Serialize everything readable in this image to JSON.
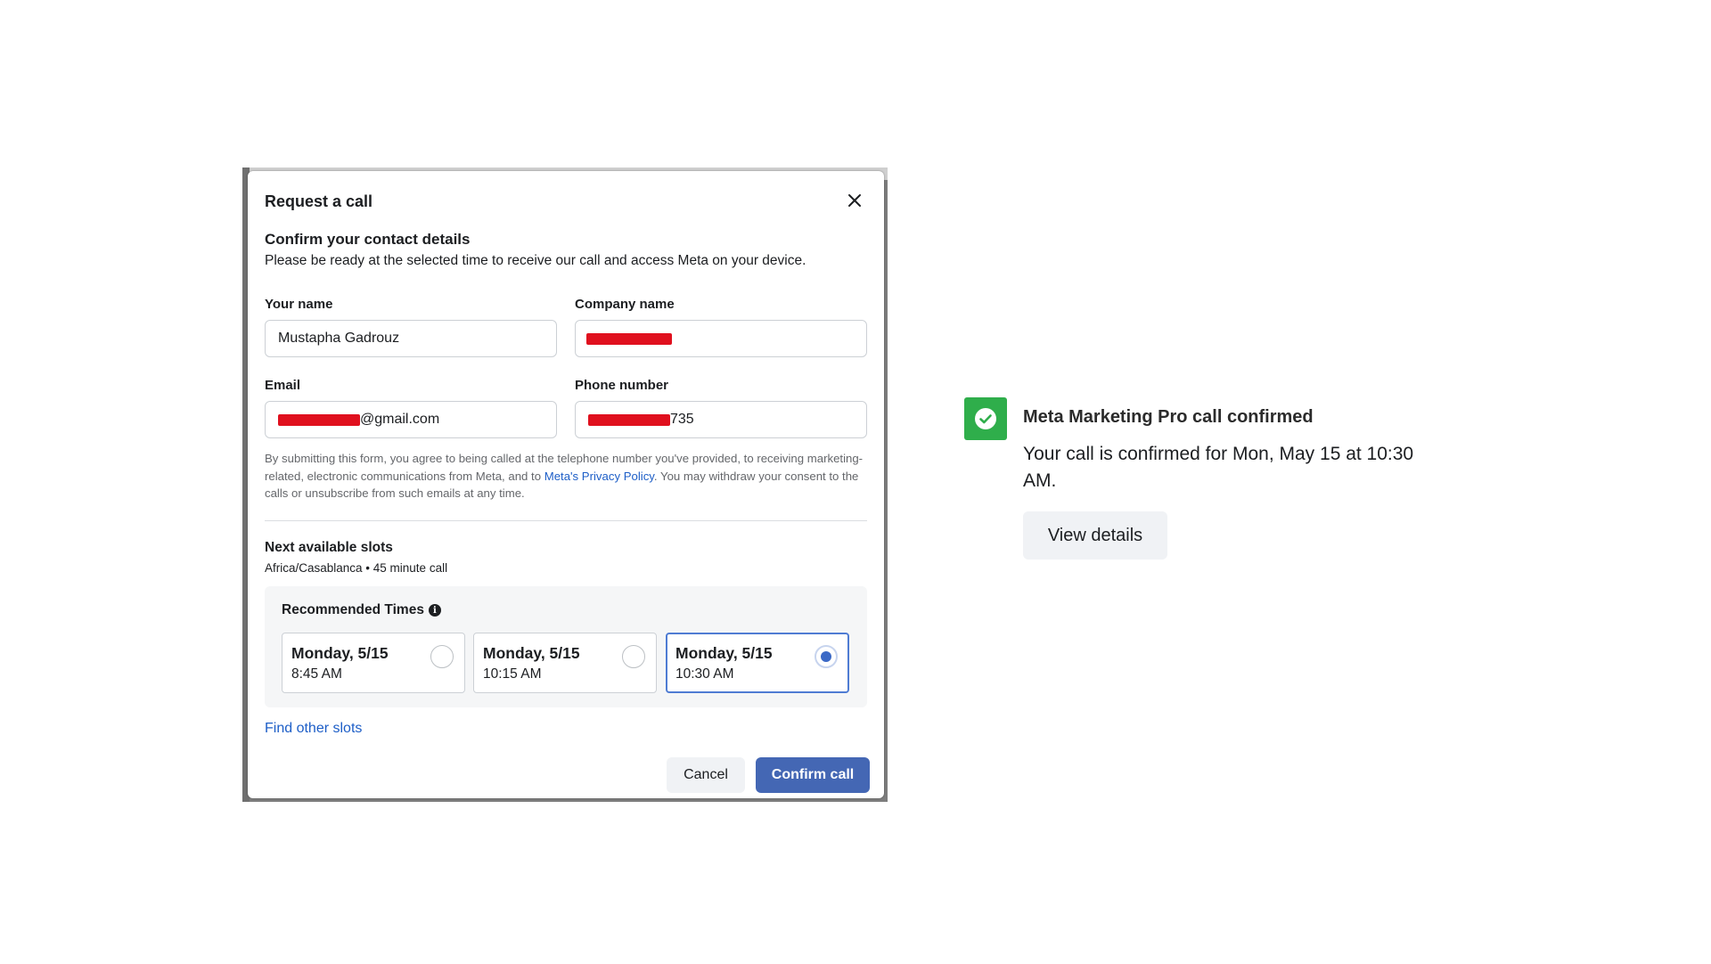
{
  "modal": {
    "title": "Request a call",
    "heading": "Confirm your contact details",
    "subheading": "Please be ready at the selected time to receive our call and access Meta on your device.",
    "fields": {
      "name": {
        "label": "Your name",
        "value": "Mustapha Gadrouz"
      },
      "company": {
        "label": "Company name",
        "value": ""
      },
      "email": {
        "label": "Email",
        "value_visible_suffix": "@gmail.com"
      },
      "phone": {
        "label": "Phone number",
        "value_visible_suffix": "735"
      }
    },
    "legal": {
      "before_link": "By submitting this form, you agree to being called at the telephone number you've provided, to receiving marketing-related, electronic communications from Meta, and to ",
      "link": "Meta's Privacy Policy",
      "after_link": ". You may withdraw your consent to the calls or unsubscribe from such emails at any time."
    },
    "slots": {
      "heading": "Next available slots",
      "subheading": "Africa/Casablanca • 45 minute call",
      "recommended_title": "Recommended Times",
      "options": [
        {
          "day": "Monday, 5/15",
          "time": "8:45 AM",
          "selected": false
        },
        {
          "day": "Monday, 5/15",
          "time": "10:15 AM",
          "selected": false
        },
        {
          "day": "Monday, 5/15",
          "time": "10:30 AM",
          "selected": true
        }
      ],
      "find_other": "Find other slots"
    },
    "buttons": {
      "cancel": "Cancel",
      "confirm": "Confirm call"
    }
  },
  "confirmation": {
    "title": "Meta Marketing Pro call confirmed",
    "text": "Your call is confirmed for Mon, May 15 at 10:30 AM.",
    "button": "View details",
    "badge_color": "#2fae4b"
  },
  "colors": {
    "primary_button": "#4467b4",
    "link": "#1d5ec7",
    "redaction": "#e0101e"
  }
}
